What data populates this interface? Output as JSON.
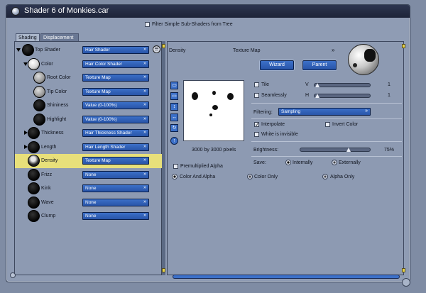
{
  "window": {
    "title": "Shader 6 of Monkies.car"
  },
  "filter": {
    "label": "Filter Simple Sub-Shaders from Tree",
    "checked": false
  },
  "tabs": [
    {
      "label": "Shading",
      "active": true
    },
    {
      "label": "Displacement",
      "active": false
    }
  ],
  "tree": [
    {
      "label": "Top Shader",
      "value": "Hair Shader"
    },
    {
      "label": "Color",
      "value": "Hair Color Shader"
    },
    {
      "label": "Root Color",
      "value": "Texture Map"
    },
    {
      "label": "Tip Color",
      "value": "Texture Map"
    },
    {
      "label": "Shininess",
      "value": "Value (0-100%)"
    },
    {
      "label": "Highlight",
      "value": "Value (0-100%)"
    },
    {
      "label": "Thickness",
      "value": "Hair Thickness Shader"
    },
    {
      "label": "Length",
      "value": "Hair Length Shader"
    },
    {
      "label": "Density",
      "value": "Texture Map"
    },
    {
      "label": "Frizz",
      "value": "None"
    },
    {
      "label": "Kink",
      "value": "None"
    },
    {
      "label": "Wave",
      "value": "None"
    },
    {
      "label": "Clump",
      "value": "None"
    }
  ],
  "detail": {
    "channel": "Density",
    "type": "Texture Map",
    "wizard_label": "Wizard",
    "parent_label": "Parent",
    "image_size": "3000 by 3000 pixels",
    "tile_label": "Tile",
    "seamlessly_label": "Seamlessly",
    "v_label": "V",
    "h_label": "H",
    "v_value": "1",
    "h_value": "1",
    "filtering_label": "Filtering:",
    "filtering_value": "Sampling",
    "interpolate_label": "Interpolate",
    "invert_label": "Invert Color",
    "white_invisible_label": "White is invisible",
    "brightness_label": "Brightness:",
    "brightness_value": "75%",
    "premultiplied_label": "Premultiplied Alpha",
    "save_label": "Save:",
    "internally_label": "Internally",
    "externally_label": "Externally",
    "color_alpha_label": "Color And Alpha",
    "color_only_label": "Color Only",
    "alpha_only_label": "Alpha Only"
  },
  "colors": {
    "accent": "#2854a8",
    "selected_row": "#e8e07a"
  }
}
